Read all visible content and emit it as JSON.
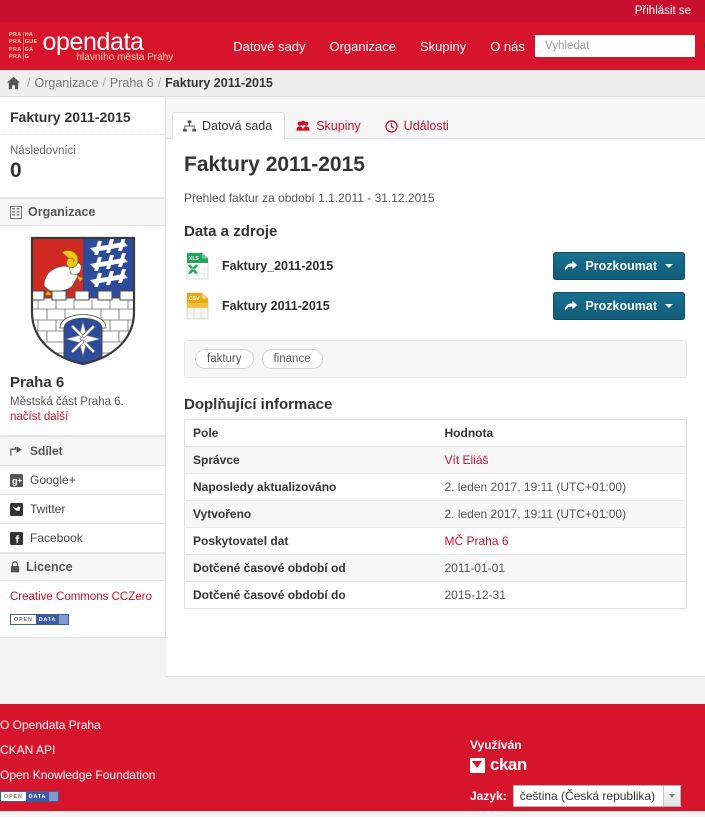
{
  "account_bar": {
    "login_label": "Přihlásit se"
  },
  "masthead": {
    "logo_grid": [
      "PRA",
      "HA",
      "PRA",
      "GUE",
      "PRA",
      "GA",
      "PRA",
      "G"
    ],
    "wordmark": "opendata",
    "tagline": "hlavního města Prahy",
    "nav": [
      {
        "label": "Datové sady",
        "name": "nav-datasets"
      },
      {
        "label": "Organizace",
        "name": "nav-organizations"
      },
      {
        "label": "Skupiny",
        "name": "nav-groups"
      },
      {
        "label": "O nás",
        "name": "nav-about"
      }
    ],
    "search": {
      "placeholder": "Vyhledat",
      "value": "",
      "icon": "search-icon"
    }
  },
  "breadcrumb": {
    "home_icon": "home-icon",
    "items": [
      {
        "label": "Organizace",
        "current": false
      },
      {
        "label": "Praha 6",
        "current": false
      },
      {
        "label": "Faktury 2011-2015",
        "current": true
      }
    ],
    "separator": "/"
  },
  "sidebar": {
    "dataset_title": "Faktury 2011-2015",
    "followers_label": "Následovníci",
    "followers_count": "0",
    "organization_heading": "Organizace",
    "organization_icon": "building-icon",
    "org_name": "Praha 6",
    "org_description": "Městská část Praha 6.",
    "org_readmore": "načíst další",
    "share_heading": "Sdílet",
    "share_icon": "share-icon",
    "share_links": [
      {
        "label": "Google+",
        "icon": "google-plus-icon"
      },
      {
        "label": "Twitter",
        "icon": "twitter-icon"
      },
      {
        "label": "Facebook",
        "icon": "facebook-icon"
      }
    ],
    "license_heading": "Licence",
    "license_icon": "lock-icon",
    "license_name": "Creative Commons CCZero",
    "opendata_badge": {
      "part1": "OPEN",
      "part2": "DATA"
    }
  },
  "main": {
    "tabs": [
      {
        "label": "Datová sada",
        "icon": "sitemap-icon",
        "active": true
      },
      {
        "label": "Skupiny",
        "icon": "group-icon",
        "active": false
      },
      {
        "label": "Události",
        "icon": "clock-icon",
        "active": false
      }
    ],
    "title": "Faktury 2011-2015",
    "notes": "Přehled faktur za období 1.1.2011 - 31.12.2015",
    "resources_heading": "Data a zdroje",
    "resources": [
      {
        "name": "Faktury_2011-2015",
        "format": "XLS",
        "icon": "xls-file-icon",
        "button": "Prozkoumat"
      },
      {
        "name": "Faktury 2011-2015",
        "format": "CSV",
        "icon": "csv-file-icon",
        "button": "Prozkoumat"
      }
    ],
    "tags": [
      "faktury",
      "finance"
    ],
    "addinfo_heading": "Doplňující informace",
    "addinfo_headers": [
      "Pole",
      "Hodnota"
    ],
    "addinfo_rows": [
      {
        "key": "Správce",
        "value": "Vít Eliáš",
        "link": true
      },
      {
        "key": "Naposledy aktualizováno",
        "value": "2. leden 2017, 19:11 (UTC+01:00)",
        "link": false
      },
      {
        "key": "Vytvořeno",
        "value": "2. leden 2017, 19:11 (UTC+01:00)",
        "link": false
      },
      {
        "key": "Poskytovatel dat",
        "value": "MČ Praha 6",
        "link": true
      },
      {
        "key": "Dotčené časové období od",
        "value": "2011-01-01",
        "link": false
      },
      {
        "key": "Dotčené časové období do",
        "value": "2015-12-31",
        "link": false
      }
    ]
  },
  "footer": {
    "links": [
      {
        "label": "O Opendata Praha"
      },
      {
        "label": "CKAN API"
      },
      {
        "label": "Open Knowledge Foundation"
      }
    ],
    "opendata_badge": {
      "part1": "OPEN",
      "part2": "DATA"
    },
    "powered_label": "Využíván",
    "ckan_word": "ckan",
    "lang_label": "Jazyk:",
    "lang_value": "čeština (Česká republika)"
  },
  "colors": {
    "brand_red": "#d6142c",
    "brand_red_dark": "#c8102e",
    "explore_blue": "#146c8b",
    "link_red": "#c8102e"
  }
}
